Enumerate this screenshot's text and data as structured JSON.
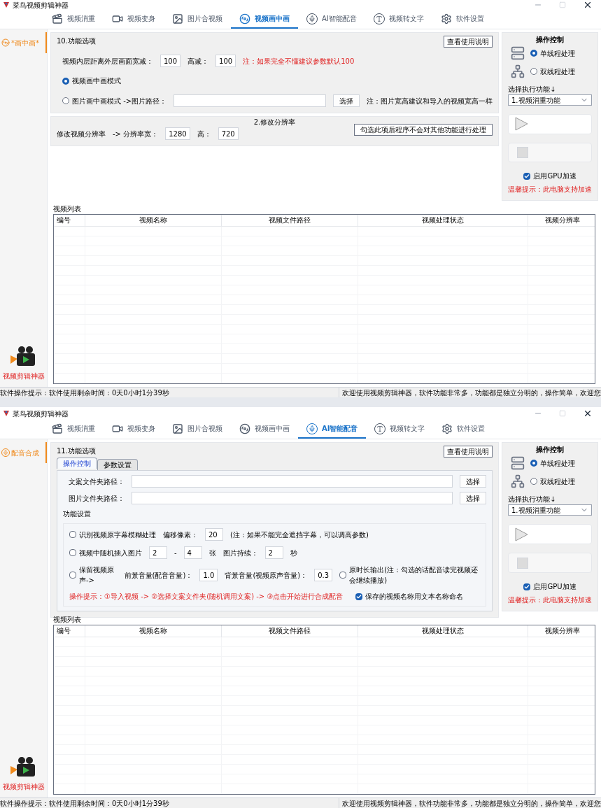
{
  "windows": [
    {
      "title": "菜鸟视频剪辑神器",
      "tabs": [
        {
          "label": "视频消重",
          "selected": false
        },
        {
          "label": "视频变身",
          "selected": false
        },
        {
          "label": "图片合视频",
          "selected": false
        },
        {
          "label": "视频画中画",
          "selected": true
        },
        {
          "label": "AI智能配音",
          "selected": false
        },
        {
          "label": "视频转文字",
          "selected": false
        },
        {
          "label": "软件设置",
          "selected": false
        }
      ],
      "side_item": {
        "kind": "reel",
        "label": "*画中画*"
      },
      "side_logo_text": "视频剪辑神器",
      "panel": {
        "kind": "pip",
        "title": "10.功能选项",
        "help_button": "查看使用说明",
        "rows": [
          {
            "items": [
              {
                "kind": "text",
                "text": "视频内层距离外层画面宽减："
              },
              {
                "kind": "input",
                "value": "100"
              },
              {
                "kind": "text",
                "text": "高减："
              },
              {
                "kind": "input",
                "value": "100"
              },
              {
                "kind": "hint",
                "text": "注：如果完全不懂建议参数默认100"
              }
            ]
          },
          {
            "items": [
              {
                "kind": "radio",
                "label": "视频画中画模式",
                "selected": true
              }
            ]
          },
          {
            "items": [
              {
                "kind": "radio",
                "label": "图片画中画模式 ->图片路径：",
                "selected": false
              },
              {
                "kind": "field"
              },
              {
                "kind": "button",
                "label": "选择"
              },
              {
                "kind": "note",
                "text": "注：图片宽高建议和导入的视频宽高一样"
              }
            ]
          }
        ],
        "section2": {
          "title": "2.修改分辨率",
          "button": "勾选此项后程序不会对其他功能进行处理",
          "rows": [
            {
              "items": [
                {
                  "kind": "text",
                  "text": "修改视频分辨率"
                },
                {
                  "kind": "text",
                  "text": "-> 分辨率宽："
                },
                {
                  "kind": "input",
                  "value": "1280"
                },
                {
                  "kind": "text",
                  "text": "高："
                },
                {
                  "kind": "input",
                  "value": "720"
                }
              ]
            }
          ]
        }
      },
      "control": {
        "title": "操作控制",
        "threads": [
          {
            "label": "单线程处理",
            "selected": true
          },
          {
            "label": "双线程处理",
            "selected": false
          }
        ],
        "select_label": "选择执行功能↓",
        "select_value": "1.视频消重功能",
        "gpu": {
          "label": "启用GPU加速",
          "checked": true
        },
        "tip": "温馨提示：此电脑支持加速"
      },
      "video_list": {
        "title": "视频列表",
        "columns": [
          "编号",
          "视频名称",
          "视频文件路径",
          "视频处理状态",
          "视频分辨率"
        ]
      },
      "status_bar": {
        "left": "软件操作提示：",
        "time": "软件使用剩余时间：0天0小时1分39秒",
        "right": "欢迎使用视频剪辑神器，软件功能非常多，功能都是独立分明的，操作简单，欢迎您"
      }
    },
    {
      "title": "菜鸟视频剪辑神器",
      "tabs": [
        {
          "label": "视频消重",
          "selected": false
        },
        {
          "label": "视频变身",
          "selected": false
        },
        {
          "label": "图片合视频",
          "selected": false
        },
        {
          "label": "视频画中画",
          "selected": false
        },
        {
          "label": "AI智能配音",
          "selected": true
        },
        {
          "label": "视频转文字",
          "selected": false
        },
        {
          "label": "软件设置",
          "selected": false
        }
      ],
      "side_item": {
        "kind": "mic",
        "label": "配音合成"
      },
      "side_logo_text": "视频剪辑神器",
      "panel": {
        "kind": "dubbing",
        "title": "11.功能选项",
        "help_button": "查看使用说明",
        "subtabs": [
          {
            "label": "操作控制",
            "selected": true
          },
          {
            "label": "参数设置",
            "selected": false
          }
        ],
        "rows": [
          {
            "items": [
              {
                "kind": "text",
                "text": "文案文件夹路径："
              },
              {
                "kind": "field"
              },
              {
                "kind": "button",
                "label": "选择"
              }
            ]
          },
          {
            "items": [
              {
                "kind": "text",
                "text": "图片文件夹路径："
              },
              {
                "kind": "field"
              },
              {
                "kind": "button",
                "label": "选择"
              }
            ]
          }
        ],
        "group": {
          "title": "功能设置",
          "rows": [
            {
              "items": [
                {
                  "kind": "check",
                  "label": "识别视频原字幕模糊处理",
                  "checked": false
                },
                {
                  "kind": "text",
                  "text": "偏移像素："
                },
                {
                  "kind": "input",
                  "value": "20"
                },
                {
                  "kind": "note",
                  "text": "(注：如果不能完全遮挡字幕，可以调高参数)"
                }
              ]
            },
            {
              "items": [
                {
                  "kind": "check",
                  "label": "视频中随机插入图片",
                  "checked": false
                },
                {
                  "kind": "input",
                  "value": "2"
                },
                {
                  "kind": "text",
                  "text": "-"
                },
                {
                  "kind": "input",
                  "value": "4"
                },
                {
                  "kind": "text",
                  "text": "张"
                },
                {
                  "kind": "text",
                  "text": "图片持续："
                },
                {
                  "kind": "input",
                  "value": "2"
                },
                {
                  "kind": "text",
                  "text": "秒"
                }
              ]
            },
            {
              "items": [
                {
                  "kind": "check",
                  "label": "保留视频原声->",
                  "checked": false
                },
                {
                  "kind": "text",
                  "text": "前景音量(配音音量)："
                },
                {
                  "kind": "input",
                  "value": "1.0"
                },
                {
                  "kind": "text",
                  "text": "背景音量(视频原声音量)："
                },
                {
                  "kind": "input",
                  "value": "0.3"
                },
                {
                  "kind": "check",
                  "label": "原时长输出(注：勾选的话配音读完视频还会继续播放)",
                  "checked": false
                }
              ]
            },
            {
              "items": [
                {
                  "kind": "hint",
                  "text": "操作提示：①导入视频 -> ②选择文案文件夹(随机调用文案) -> ③点击开始进行合成配音"
                },
                {
                  "kind": "check",
                  "label": "保存的视频名称用文本名称命名",
                  "checked": true
                }
              ]
            }
          ]
        }
      },
      "control": {
        "title": "操作控制",
        "threads": [
          {
            "label": "单线程处理",
            "selected": true
          },
          {
            "label": "双线程处理",
            "selected": false
          }
        ],
        "select_label": "选择执行功能↓",
        "select_value": "1.视频消重功能",
        "gpu": {
          "label": "启用GPU加速",
          "checked": true
        },
        "tip": "温馨提示：此电脑支持加速"
      },
      "video_list": {
        "title": "视频列表",
        "columns": [
          "编号",
          "视频名称",
          "视频文件路径",
          "视频处理状态",
          "视频分辨率"
        ]
      },
      "status_bar": {
        "left": "软件操作提示：",
        "time": "软件使用剩余时间：0天0小时1分39秒",
        "right": "欢迎使用视频剪辑神器，软件功能非常多，功能都是独立分明的，操作简单，欢迎您"
      }
    }
  ]
}
